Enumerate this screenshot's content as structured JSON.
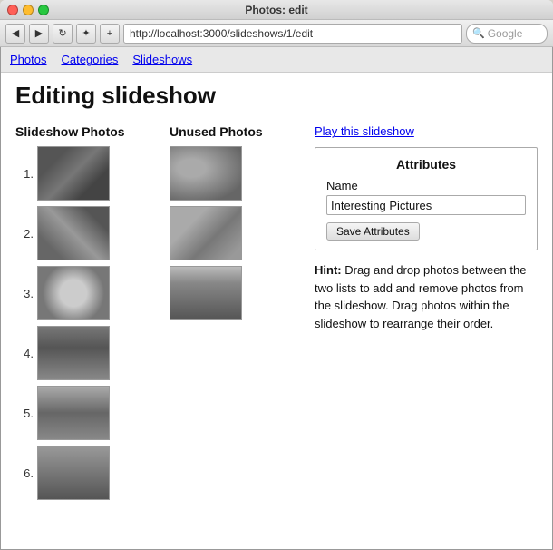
{
  "window": {
    "title": "Photos: edit",
    "url": "http://localhost:3000/slideshows/1/edit"
  },
  "toolbar": {
    "back_label": "◀",
    "forward_label": "▶",
    "refresh_label": "↻",
    "bookmark_label": "✦",
    "add_label": "+",
    "search_placeholder": "Google"
  },
  "nav": {
    "links": [
      {
        "label": "Photos"
      },
      {
        "label": "Categories"
      },
      {
        "label": "Slideshows"
      }
    ]
  },
  "page": {
    "heading": "Editing slideshow",
    "slideshow_col_header": "Slideshow Photos",
    "unused_col_header": "Unused Photos",
    "play_link": "Play this slideshow",
    "attributes": {
      "box_title": "Attributes",
      "name_label": "Name",
      "name_value": "Interesting Pictures",
      "save_button": "Save Attributes"
    },
    "hint": {
      "prefix": "Hint:",
      "text": " Drag and drop photos between the two lists to add and remove photos from the slideshow. Drag photos within the slideshow to rearrange their order."
    },
    "slideshow_photos": [
      {
        "number": "1.",
        "thumb_class": "thumb-bus"
      },
      {
        "number": "2.",
        "thumb_class": "thumb-indoor"
      },
      {
        "number": "3.",
        "thumb_class": "thumb-round"
      },
      {
        "number": "4.",
        "thumb_class": "thumb-building"
      },
      {
        "number": "5.",
        "thumb_class": "thumb-bridge"
      },
      {
        "number": "6.",
        "thumb_class": "thumb-landscape"
      }
    ],
    "unused_photos": [
      {
        "thumb_class": "thumb-bird"
      },
      {
        "thumb_class": "thumb-objects"
      },
      {
        "thumb_class": "thumb-lighthouse"
      }
    ]
  }
}
